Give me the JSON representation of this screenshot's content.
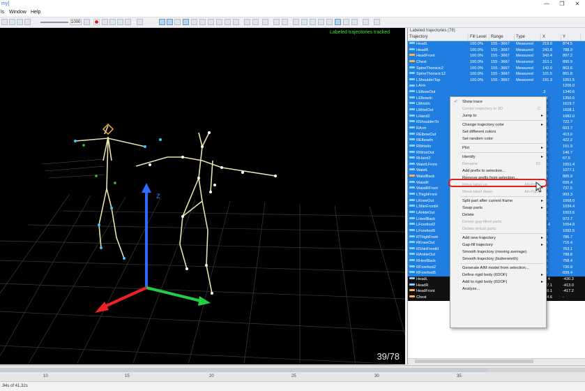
{
  "window": {
    "title": "my]",
    "menu": [
      "ls",
      "Window",
      "Help"
    ],
    "controls": {
      "minimize": "—",
      "restore": "❐",
      "close": "✕"
    }
  },
  "toolbar": {
    "zoom": "1000",
    "icons": [
      "play-first-icon",
      "play-prev-icon",
      "play-next-icon",
      "play-last-icon",
      "playback-slider",
      "zoom-icon",
      "record-icon",
      "select-icon",
      "marker-icon",
      "trajectory-icon",
      "skeleton-icon",
      "view-2d-icon",
      "view-3d-icon",
      "force-icon",
      "video-icon",
      "camera-icon",
      "calibrate-icon",
      "settings-icon",
      "layout-icon",
      "window-icon",
      "help-icon"
    ]
  },
  "viewport": {
    "label": "Labeled trajectories tracked",
    "frame_counter": "39/78",
    "axis_label": "z"
  },
  "panel": {
    "title": "Labeled trajectories (78)",
    "columns": [
      "Trajectory",
      "Fill Level",
      "Range",
      "Type",
      "X",
      "Y"
    ],
    "rows": [
      {
        "name": "HeadL",
        "fill": "100.0%",
        "range": "155 - 3667",
        "type": "Measured",
        "x": "219.0",
        "y": "874.5",
        "color": "#7fd3ff"
      },
      {
        "name": "HeadR",
        "fill": "100.0%",
        "range": "155 - 3667",
        "type": "Measured",
        "x": "243.8",
        "y": "788.9",
        "color": "#7fd3ff"
      },
      {
        "name": "HeadFront",
        "fill": "100.0%",
        "range": "155 - 3667",
        "type": "Measured",
        "x": "342.4",
        "y": "897.2",
        "color": "#ffb347"
      },
      {
        "name": "Chest",
        "fill": "100.0%",
        "range": "155 - 3667",
        "type": "Measured",
        "x": "310.1",
        "y": "890.9",
        "color": "#ffb347"
      },
      {
        "name": "SpineThoracic2",
        "fill": "100.0%",
        "range": "155 - 3667",
        "type": "Measured",
        "x": "142.0",
        "y": "863.6",
        "color": "#7fd3ff"
      },
      {
        "name": "SpineThoracic12",
        "fill": "100.0%",
        "range": "155 - 3667",
        "type": "Measured",
        "x": "101.5",
        "y": "861.8",
        "color": "#7fd3ff"
      },
      {
        "name": "LShoulderTop",
        "fill": "100.0%",
        "range": "155 - 3667",
        "type": "Measured",
        "x": "191.3",
        "y": "1051.5",
        "color": "#7fd3ff"
      },
      {
        "name": "LArm",
        "fill": "",
        "range": "",
        "type": "",
        "x": "",
        "y": "1206.0",
        "color": "#7fd3ff"
      },
      {
        "name": "LElbowOut",
        "fill": "",
        "range": "",
        "type": "",
        "x": ".2",
        "y": "1340.6",
        "color": "#7fd3ff"
      },
      {
        "name": "LElbowIn",
        "fill": "",
        "range": "",
        "type": "",
        "x": "7.1",
        "y": "1350.5",
        "color": "#7fd3ff"
      },
      {
        "name": "LWristIn",
        "fill": "",
        "range": "",
        "type": "",
        "x": "0.5",
        "y": "1619.7",
        "color": "#7fd3ff"
      },
      {
        "name": "LWristOut",
        "fill": "",
        "range": "",
        "type": "",
        "x": "1.0",
        "y": "1608.1",
        "color": "#7fd3ff"
      },
      {
        "name": "LHand2",
        "fill": "",
        "range": "",
        "type": "",
        "x": "2.8",
        "y": "1682.0",
        "color": "#7fd3ff"
      },
      {
        "name": "RShoulderTo",
        "fill": "",
        "range": "",
        "type": "",
        "x": "2.7",
        "y": "722.7",
        "color": "#7fd3ff"
      },
      {
        "name": "RArm",
        "fill": "",
        "range": "",
        "type": "",
        "x": "1.6",
        "y": "603.7",
        "color": "#7fd3ff"
      },
      {
        "name": "RElbowOut",
        "fill": "",
        "range": "",
        "type": "",
        "x": "0.3",
        "y": "413.0",
        "color": "#7fd3ff"
      },
      {
        "name": "RElbowIn",
        "fill": "",
        "range": "",
        "type": "",
        "x": "7.2",
        "y": "422.2",
        "color": "#7fd3ff"
      },
      {
        "name": "RWristIn",
        "fill": "",
        "range": "",
        "type": "",
        "x": "1.5",
        "y": "151.9",
        "color": "#7fd3ff"
      },
      {
        "name": "RWristOut",
        "fill": "",
        "range": "",
        "type": "",
        "x": "5.0",
        "y": "146.7",
        "color": "#7fd3ff"
      },
      {
        "name": "RHand2",
        "fill": "",
        "range": "",
        "type": "",
        "x": "5.1",
        "y": "67.5",
        "color": "#7fd3ff"
      },
      {
        "name": "WaistLFront",
        "fill": "",
        "range": "",
        "type": "",
        "x": "7.6",
        "y": "1051.4",
        "color": "#7fd3ff"
      },
      {
        "name": "WaistL",
        "fill": "",
        "range": "",
        "type": "",
        "x": "4.5",
        "y": "1077.1",
        "color": "#7fd3ff"
      },
      {
        "name": "WaistBack",
        "fill": "",
        "range": "",
        "type": "",
        "x": "2.1",
        "y": "885.9",
        "color": "#ffb347"
      },
      {
        "name": "WaistR",
        "fill": "",
        "range": "",
        "type": "",
        "x": "5.6",
        "y": "699.4",
        "color": "#7fd3ff"
      },
      {
        "name": "WaistRFront",
        "fill": "",
        "range": "",
        "type": "",
        "x": "0.5",
        "y": "737.5",
        "color": "#7fd3ff"
      },
      {
        "name": "LThighFront",
        "fill": "",
        "range": "",
        "type": "",
        "x": "8.1",
        "y": "993.3",
        "color": "#7fd3ff"
      },
      {
        "name": "LKneeOut",
        "fill": "",
        "range": "",
        "type": "",
        "x": "2.0",
        "y": "1068.0",
        "color": "#7fd3ff"
      },
      {
        "name": "LShinFrontH",
        "fill": "",
        "range": "",
        "type": "",
        "x": "3.5",
        "y": "1034.4",
        "color": "#7fd3ff"
      },
      {
        "name": "LAnkleOut",
        "fill": "",
        "range": "",
        "type": "",
        "x": "9.5",
        "y": "1003.6",
        "color": "#7fd3ff"
      },
      {
        "name": "LHeelBack",
        "fill": "",
        "range": "",
        "type": "",
        "x": "9.8",
        "y": "972.7",
        "color": "#7fd3ff"
      },
      {
        "name": "LForefoot2",
        "fill": "",
        "range": "",
        "type": "",
        "x": "15.4",
        "y": "1054.9",
        "color": "#7fd3ff"
      },
      {
        "name": "LForefoot5",
        "fill": "",
        "range": "",
        "type": "",
        "x": "1.2",
        "y": "1092.5",
        "color": "#7fd3ff"
      },
      {
        "name": "RThighFront",
        "fill": "",
        "range": "",
        "type": "",
        "x": "6.1",
        "y": "786.7",
        "color": "#7fd3ff"
      },
      {
        "name": "RKneeOut",
        "fill": "",
        "range": "",
        "type": "",
        "x": "5.4",
        "y": "716.4",
        "color": "#7fd3ff"
      },
      {
        "name": "RShinFrontH",
        "fill": "",
        "range": "",
        "type": "",
        "x": "0.1",
        "y": "763.1",
        "color": "#7fd3ff"
      },
      {
        "name": "RAnkleOut",
        "fill": "",
        "range": "",
        "type": "",
        "x": "8.9",
        "y": "788.8",
        "color": "#7fd3ff"
      },
      {
        "name": "RHeelBack",
        "fill": "",
        "range": "",
        "type": "",
        "x": "5.5",
        "y": "758.4",
        "color": "#7fd3ff"
      },
      {
        "name": "RForefoot2",
        "fill": "",
        "range": "",
        "type": "",
        "x": "7.6",
        "y": "730.9",
        "color": "#7fd3ff"
      },
      {
        "name": "RForefoot5",
        "fill": "",
        "range": "",
        "type": "",
        "x": "5.6",
        "y": "699.4",
        "color": "#7fd3ff"
      },
      {
        "name": "HeadL",
        "fill": "100.0%",
        "range": "155 - 3667",
        "type": "Measured",
        "x": "71.4",
        "y": "-430.3",
        "color": "#7fd3ff"
      },
      {
        "name": "HeadR",
        "fill": "100.0%",
        "range": "155 - 3667",
        "type": "Measured",
        "x": "147.1",
        "y": "-413.0",
        "color": "#7fd3ff"
      },
      {
        "name": "HeadFront",
        "fill": "100.0%",
        "range": "155 - 3667",
        "type": "Measured",
        "x": "208.1",
        "y": "-417.2",
        "color": "#ffb347"
      },
      {
        "name": "Chest",
        "fill": "100.0%",
        "range": "155 - 3667",
        "type": "Measured",
        "x": "174.6",
        "y": "-",
        "color": "#ffb347"
      }
    ]
  },
  "context_menu": {
    "items": [
      {
        "label": "Show trace",
        "checked": true
      },
      {
        "label": "Center trajectory in 3D",
        "disabled": true,
        "shortcut": "C"
      },
      {
        "label": "Jump to",
        "submenu": true
      },
      {
        "separator": true
      },
      {
        "label": "Change trajectory color",
        "submenu": true
      },
      {
        "label": "Set different colors"
      },
      {
        "label": "Set random color"
      },
      {
        "separator": true
      },
      {
        "label": "Plot",
        "submenu": true
      },
      {
        "separator": true
      },
      {
        "label": "Identify",
        "submenu": true
      },
      {
        "label": "Rename",
        "disabled": true,
        "shortcut": "F2"
      },
      {
        "label": "Add prefix to selection...",
        "highlighted": true
      },
      {
        "label": "Remove prefix from selection..."
      },
      {
        "label": "Move label up",
        "disabled": true,
        "shortcut": "Alt+PgUp"
      },
      {
        "label": "Move label down",
        "disabled": true,
        "shortcut": "Alt+PgDn"
      },
      {
        "separator": true
      },
      {
        "label": "Split part after current frame",
        "submenu": true
      },
      {
        "label": "Swap parts",
        "submenu": true
      },
      {
        "label": "Delete"
      },
      {
        "label": "Delete gap-filled parts",
        "disabled": true
      },
      {
        "label": "Delete virtual parts",
        "disabled": true
      },
      {
        "separator": true
      },
      {
        "label": "Add new trajectory",
        "submenu": true
      },
      {
        "label": "Gap-fill trajectory",
        "submenu": true
      },
      {
        "label": "Smooth trajectory (moving average)"
      },
      {
        "label": "Smooth trajectory (butterworth)"
      },
      {
        "separator": true
      },
      {
        "label": "Generate AIM model from selection..."
      },
      {
        "label": "Define rigid body (6DOF)",
        "submenu": true
      },
      {
        "label": "Add to rigid body (6DOF)",
        "submenu": true
      },
      {
        "label": "Analyze..."
      }
    ]
  },
  "timeline": {
    "ticks": [
      "10",
      "15",
      "20",
      "25",
      "30",
      "35"
    ]
  },
  "status": {
    "text": ".94s of 41.32s"
  }
}
